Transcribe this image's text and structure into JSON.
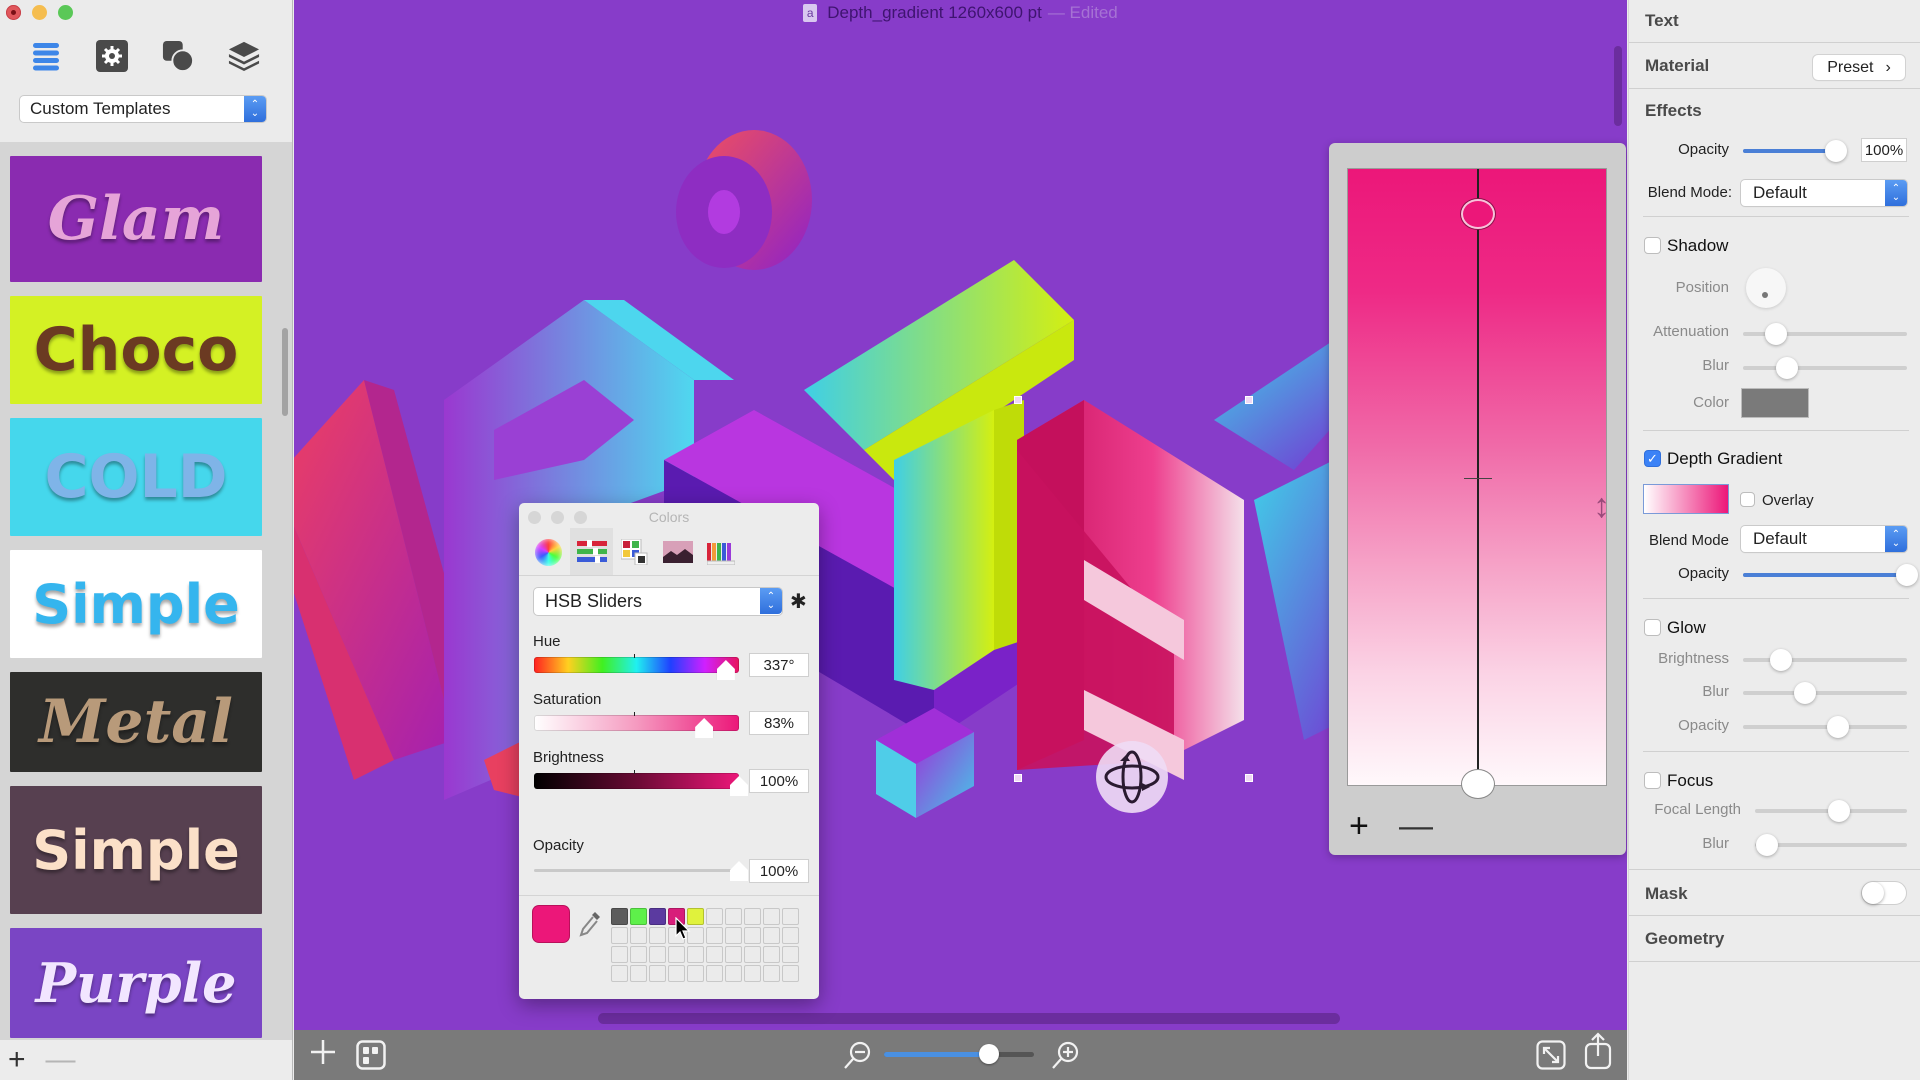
{
  "window": {
    "title": "Depth_gradient 1260x600 pt",
    "status": "— Edited",
    "doc_icon": "a"
  },
  "sidebar": {
    "mode_icons": [
      "list-icon",
      "gear-icon",
      "shapes-icon",
      "layers-icon"
    ],
    "template_select": {
      "value": "Custom Templates"
    },
    "templates": [
      {
        "label": "Glam",
        "bg": "#8a2bb0",
        "fg": "#e6a4d8",
        "style": "script"
      },
      {
        "label": "Choco",
        "bg": "#d4f124",
        "fg": "#6b3a22",
        "style": "bold"
      },
      {
        "label": "COLD",
        "bg": "#45d7ec",
        "fg": "#7fb4e8",
        "style": "bold"
      },
      {
        "label": "Simple",
        "bg": "#ffffff",
        "fg": "#35b5ee",
        "style": "bold"
      },
      {
        "label": "Metal",
        "bg": "#2e2e2c",
        "fg": "#b89a7a",
        "style": "script"
      },
      {
        "label": "Simple",
        "bg": "#574050",
        "fg": "#fbe0c8",
        "style": "bold"
      },
      {
        "label": "Purple",
        "bg": "#7a45c4",
        "fg": "#f2e6ff",
        "style": "script"
      }
    ],
    "bottom": {
      "add": "+",
      "remove": "—"
    }
  },
  "canvas": {
    "background": "#873cc9",
    "letters": [
      "A",
      "R",
      "T",
      "E",
      "X"
    ]
  },
  "bottom_toolbar": {
    "zoom_level": 0.7
  },
  "colors_panel": {
    "title": "Colors",
    "modes": [
      "color-wheel",
      "color-sliders",
      "color-palettes",
      "image-palettes",
      "pencils"
    ],
    "active_mode": 1,
    "slider_type": "HSB Sliders",
    "hue": {
      "label": "Hue",
      "value": "337°",
      "fraction": 0.936
    },
    "saturation": {
      "label": "Saturation",
      "value": "83%",
      "fraction": 0.83
    },
    "brightness": {
      "label": "Brightness",
      "value": "100%",
      "fraction": 1.0
    },
    "opacity": {
      "label": "Opacity",
      "value": "100%",
      "fraction": 1.0
    },
    "current_color": "#ec1779",
    "swatches": [
      "#5c5c5c",
      "#5ef04a",
      "#5b3aa0",
      "#d81d7a",
      "#e0f23c"
    ]
  },
  "gradient_editor": {
    "top_color": "#ec1779",
    "bottom_color": "#ffffff",
    "add": "+",
    "remove": "—"
  },
  "inspector": {
    "text": "Text",
    "material": {
      "label": "Material",
      "preset": "Preset"
    },
    "effects": {
      "label": "Effects",
      "opacity_label": "Opacity",
      "opacity_value": "100%",
      "opacity_fraction": 0.95,
      "blend_label": "Blend Mode:",
      "blend_value": "Default"
    },
    "shadow": {
      "label": "Shadow",
      "checked": false,
      "position_label": "Position",
      "attenuation_label": "Attenuation",
      "attenuation_fraction": 0.2,
      "blur_label": "Blur",
      "blur_fraction": 0.27,
      "color_label": "Color",
      "color": "#7a7a7a"
    },
    "depth_gradient": {
      "label": "Depth Gradient",
      "checked": true,
      "overlay_label": "Overlay",
      "overlay_checked": false,
      "blend_label": "Blend Mode",
      "blend_value": "Default",
      "opacity_label": "Opacity",
      "opacity_fraction": 1.0
    },
    "glow": {
      "label": "Glow",
      "checked": false,
      "brightness_label": "Brightness",
      "brightness_fraction": 0.23,
      "blur_label": "Blur",
      "blur_fraction": 0.38,
      "opacity_label": "Opacity",
      "opacity_fraction": 0.58
    },
    "focus": {
      "label": "Focus",
      "checked": false,
      "focal_length_label": "Focal Length",
      "focal_length_fraction": 0.55,
      "blur_label": "Blur",
      "blur_fraction": 0.08
    },
    "mask": {
      "label": "Mask",
      "on": false
    },
    "geometry": {
      "label": "Geometry"
    }
  }
}
